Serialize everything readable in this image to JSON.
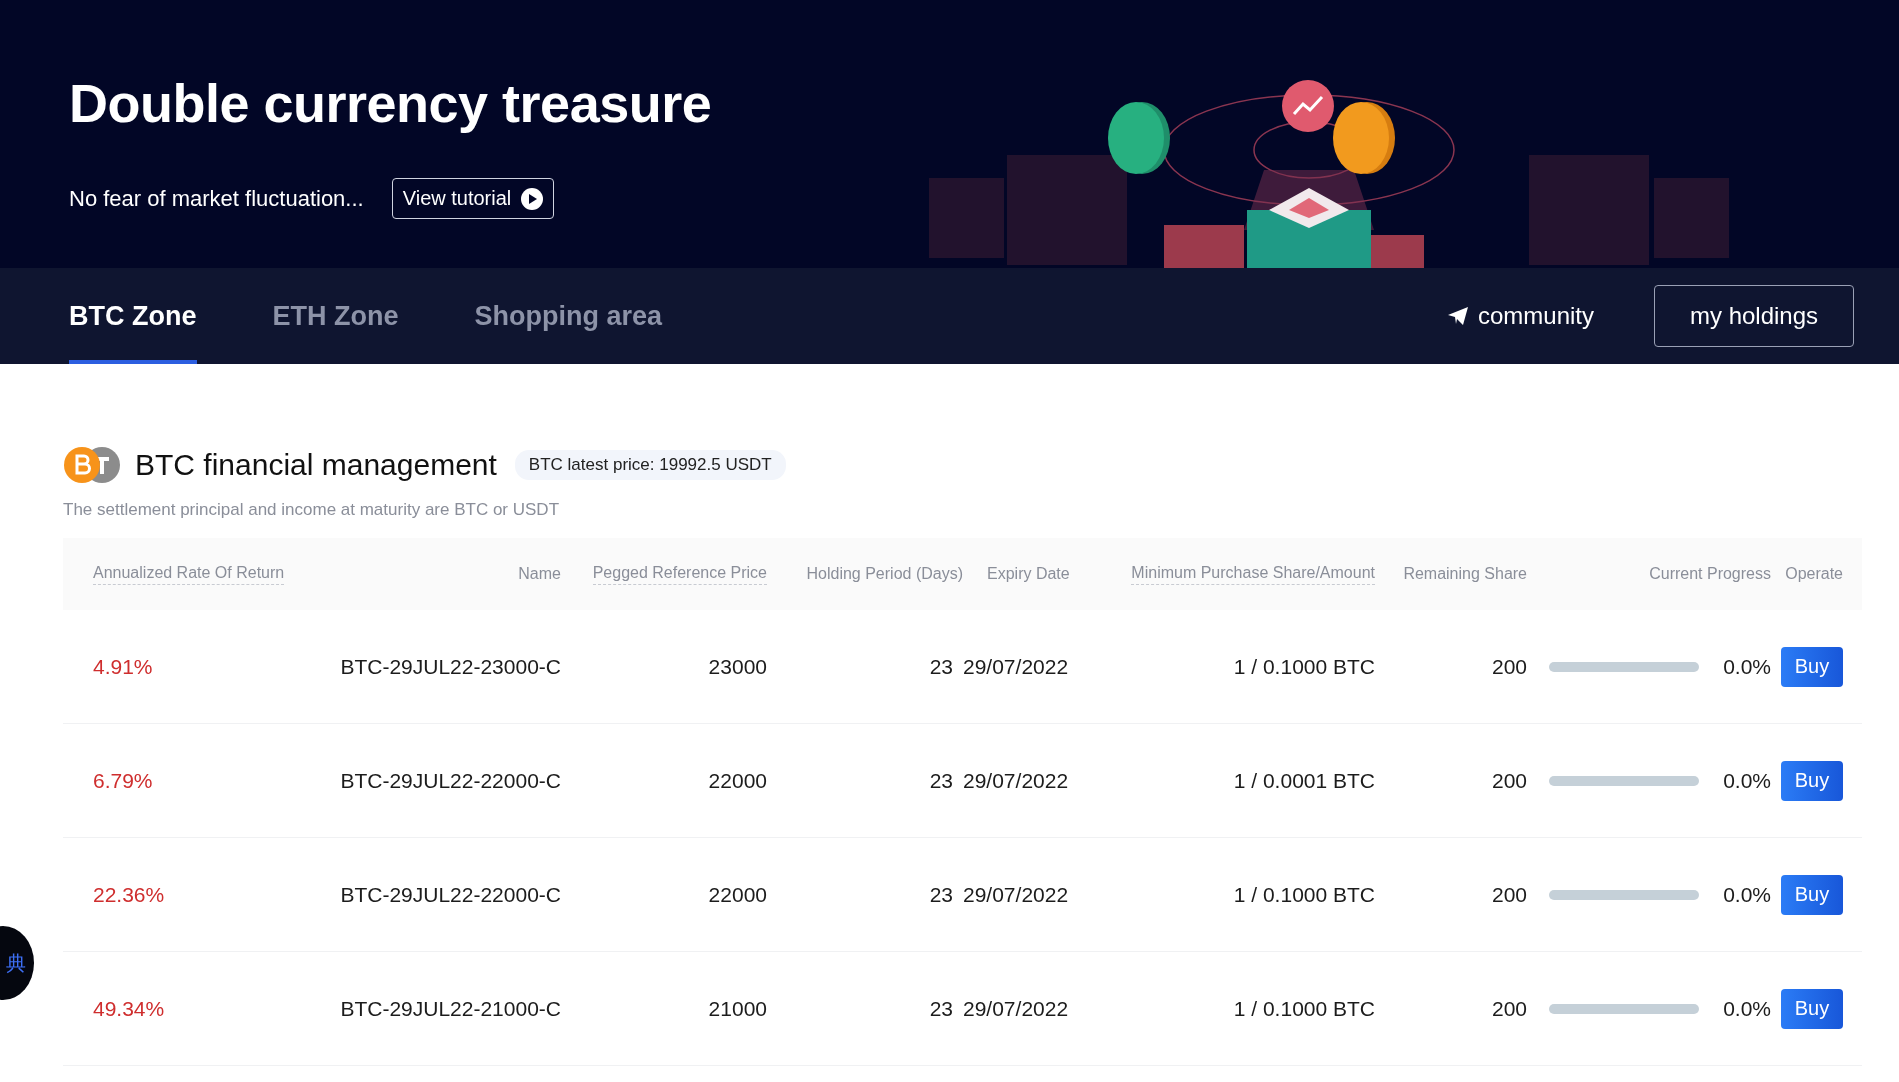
{
  "hero": {
    "title": "Double currency treasure",
    "subtitle": "No fear of market fluctuation...",
    "tutorial_button": "View tutorial"
  },
  "tabs": [
    {
      "label": "BTC Zone",
      "selected": true
    },
    {
      "label": "ETH Zone",
      "selected": false
    },
    {
      "label": "Shopping area",
      "selected": false
    }
  ],
  "nav_actions": {
    "community": "community",
    "holdings": "my holdings"
  },
  "section": {
    "title": "BTC financial management",
    "price_badge": "BTC latest price: 19992.5 USDT",
    "note": "The settlement principal and income at maturity are BTC or USDT"
  },
  "table": {
    "columns": [
      {
        "label": "Annualized Rate Of Return",
        "hint": true
      },
      {
        "label": "Name",
        "hint": false
      },
      {
        "label": "Pegged Reference Price",
        "hint": true
      },
      {
        "label": "Holding Period (Days)",
        "hint": false
      },
      {
        "label": "Expiry Date",
        "hint": false
      },
      {
        "label": "Minimum Purchase Share/Amount",
        "hint": true
      },
      {
        "label": "Remaining Share",
        "hint": false
      },
      {
        "label": "Current Progress",
        "hint": false
      },
      {
        "label": "Operate",
        "hint": false
      }
    ],
    "rows": [
      {
        "rate": "4.91%",
        "name": "BTC-29JUL22-23000-C",
        "price": "23000",
        "days": "23",
        "expiry": "29/07/2022",
        "minimum": "1 / 0.1000 BTC",
        "remaining": "200",
        "level": 0,
        "progress": "0.0%",
        "action": "Buy"
      },
      {
        "rate": "6.79%",
        "name": "BTC-29JUL22-22000-C",
        "price": "22000",
        "days": "23",
        "expiry": "29/07/2022",
        "minimum": "1 / 0.0001 BTC",
        "remaining": "200",
        "level": 0,
        "progress": "0.0%",
        "action": "Buy"
      },
      {
        "rate": "22.36%",
        "name": "BTC-29JUL22-22000-C",
        "price": "22000",
        "days": "23",
        "expiry": "29/07/2022",
        "minimum": "1 / 0.1000 BTC",
        "remaining": "200",
        "level": 0,
        "progress": "0.0%",
        "action": "Buy"
      },
      {
        "rate": "49.34%",
        "name": "BTC-29JUL22-21000-C",
        "price": "21000",
        "days": "23",
        "expiry": "29/07/2022",
        "minimum": "1 / 0.1000 BTC",
        "remaining": "200",
        "level": 0,
        "progress": "0.0%",
        "action": "Buy"
      }
    ]
  },
  "floating_button": "典"
}
